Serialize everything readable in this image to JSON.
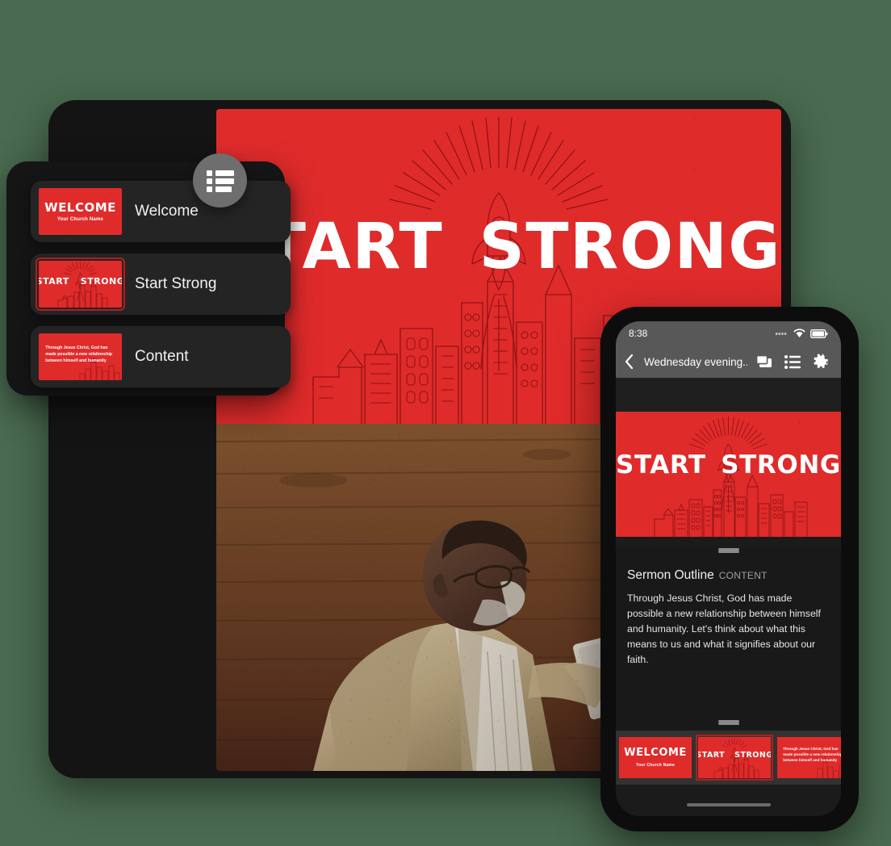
{
  "theme": {
    "brand_red": "#E02B2B",
    "dark_panel": "#151515",
    "row_bg": "#242424",
    "app_bar_gray": "#585858",
    "background_green": "#4A6B50"
  },
  "series_title": "START STRONG",
  "slide_list_panel": {
    "fab_icon": "list-icon",
    "items": [
      {
        "label": "Welcome",
        "selected": false,
        "thumbnail": {
          "kind": "welcome",
          "title": "WELCOME",
          "subtitle": "Your Church Name"
        }
      },
      {
        "label": "Start Strong",
        "selected": true,
        "thumbnail": {
          "kind": "title",
          "word1": "START",
          "word2": "STRONG"
        }
      },
      {
        "label": "Content",
        "selected": false,
        "thumbnail": {
          "kind": "content",
          "text": "Through Jesus Christ, God has made possible a new relationship between himself and humanity"
        }
      }
    ]
  },
  "tablet": {
    "slide": {
      "word1": "START",
      "word2": "STRONG"
    },
    "photo_alt": "Speaker presenting at a wooden-walled venue holding a tablet"
  },
  "phone": {
    "status_bar": {
      "time": "8:38",
      "signal_icon": "signal-icon",
      "wifi_icon": "wifi-icon",
      "battery_icon": "battery-icon"
    },
    "app_bar": {
      "back_icon": "back-chevron-icon",
      "title": "Wednesday evening...",
      "actions": [
        {
          "icon": "slides-layers-icon",
          "name": "slides-button"
        },
        {
          "icon": "list-icon",
          "name": "outline-button"
        },
        {
          "icon": "gear-icon",
          "name": "settings-button"
        }
      ]
    },
    "slide": {
      "word1": "START",
      "word2": "STRONG"
    },
    "outline": {
      "heading": "Sermon Outline",
      "kicker": "CONTENT",
      "body": "Through Jesus Christ, God has made possible a new relationship between himself and humanity. Let's think about what this means to us and what it signifies about our faith."
    },
    "thumb_strip": [
      {
        "kind": "welcome",
        "title": "WELCOME",
        "subtitle": "Your Church Name",
        "selected": false
      },
      {
        "kind": "title",
        "word1": "START",
        "word2": "STRONG",
        "selected": true
      },
      {
        "kind": "content",
        "text": "Through Jesus Christ, God has made possible a new relationship between himself and humanity",
        "selected": false
      }
    ]
  }
}
